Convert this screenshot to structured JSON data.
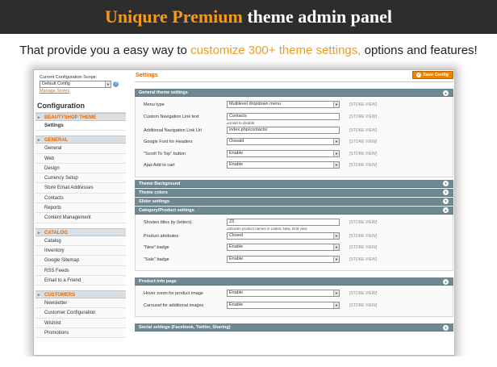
{
  "banner": {
    "accent": "Uniqure Premium",
    "rest": " theme admin panel"
  },
  "subtitle": {
    "pre": "That provide you a easy way to ",
    "accent": "customize 300+ theme settings,",
    "post": " options and features!"
  },
  "sidebar": {
    "scope_label": "Current Configuration Scope:",
    "scope_value": "Default Config",
    "manage_stores": "Manage Stores",
    "title": "Configuration",
    "sections": [
      {
        "heading": "BEAUTYSHOP THEME",
        "items": [
          "Settings"
        ]
      },
      {
        "heading": "GENERAL",
        "items": [
          "General",
          "Web",
          "Design",
          "Currency Setup",
          "Store Email Addresses",
          "Contacts",
          "Reports",
          "Content Management"
        ]
      },
      {
        "heading": "CATALOG",
        "items": [
          "Catalog",
          "Inventory",
          "Google Sitemap",
          "RSS Feeds",
          "Email to a Friend"
        ]
      },
      {
        "heading": "CUSTOMERS",
        "items": [
          "Newsletter",
          "Customer Configuration",
          "Wishlist",
          "Promotions"
        ]
      }
    ]
  },
  "main": {
    "title": "Settings",
    "save_label": "Save Config",
    "store_view": "[STORE VIEW]",
    "general": {
      "heading": "General theme settings",
      "rows": [
        {
          "label": "Menu type",
          "value": "Multilevel dropdown menu",
          "kind": "select"
        },
        {
          "label": "Custom Navigation Link text",
          "value": "Contacts",
          "kind": "text",
          "note": "Unset to disable"
        },
        {
          "label": "Additional Navigation Link Url",
          "value": "index.php/contacts/",
          "kind": "text"
        },
        {
          "label": "Google Font for Headers",
          "value": "Oswald",
          "kind": "select"
        },
        {
          "label": "\"Scroll To Top\" button",
          "value": "Enable",
          "kind": "select"
        },
        {
          "label": "Ajax Add to cart",
          "value": "Enable",
          "kind": "select"
        }
      ]
    },
    "collapsed": [
      "Theme Background",
      "Theme colors",
      "Slider settings"
    ],
    "category": {
      "heading": "Category/Product settings",
      "rows": [
        {
          "label": "Shorten titles by (letters)",
          "value": "23",
          "kind": "text",
          "note": "Shorten product names in Latest, New, Grid view"
        },
        {
          "label": "Product attributes",
          "value": "Closed",
          "kind": "select"
        },
        {
          "label": "\"New\" badge",
          "value": "Enable",
          "kind": "select"
        },
        {
          "label": "\"Sale\" badge",
          "value": "Enable",
          "kind": "select"
        }
      ]
    },
    "product_info": {
      "heading": "Product info page",
      "rows": [
        {
          "label": "Hover zoom for product image",
          "value": "Enable",
          "kind": "select"
        },
        {
          "label": "Carousel for additional images",
          "value": "Enable",
          "kind": "select"
        }
      ]
    },
    "social": {
      "heading": "Social settings (Facebook, Twitter, Sharing)"
    }
  }
}
